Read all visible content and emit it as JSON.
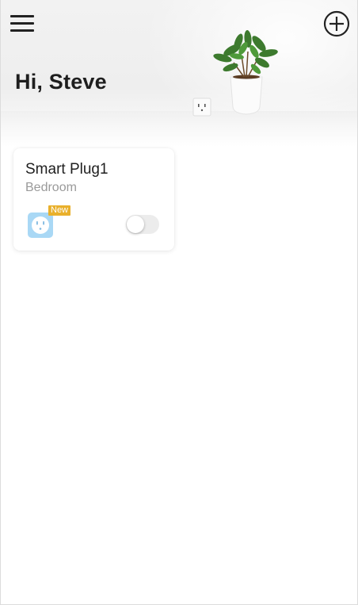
{
  "header": {
    "greeting": "Hi, Steve",
    "menu_icon": "hamburger-menu-icon",
    "add_icon": "add-circle-icon"
  },
  "devices": [
    {
      "name": "Smart Plug1",
      "room": "Bedroom",
      "badge": "New",
      "icon": "smart-plug-icon",
      "status_icon": "schedule-moon-icon",
      "power_on": false
    }
  ],
  "colors": {
    "badge": "#e9b02b",
    "plug_icon": "#a9d8f5",
    "toggle_off": "#ececec",
    "text_primary": "#1f1f1f",
    "text_secondary": "#9a9a9a"
  }
}
